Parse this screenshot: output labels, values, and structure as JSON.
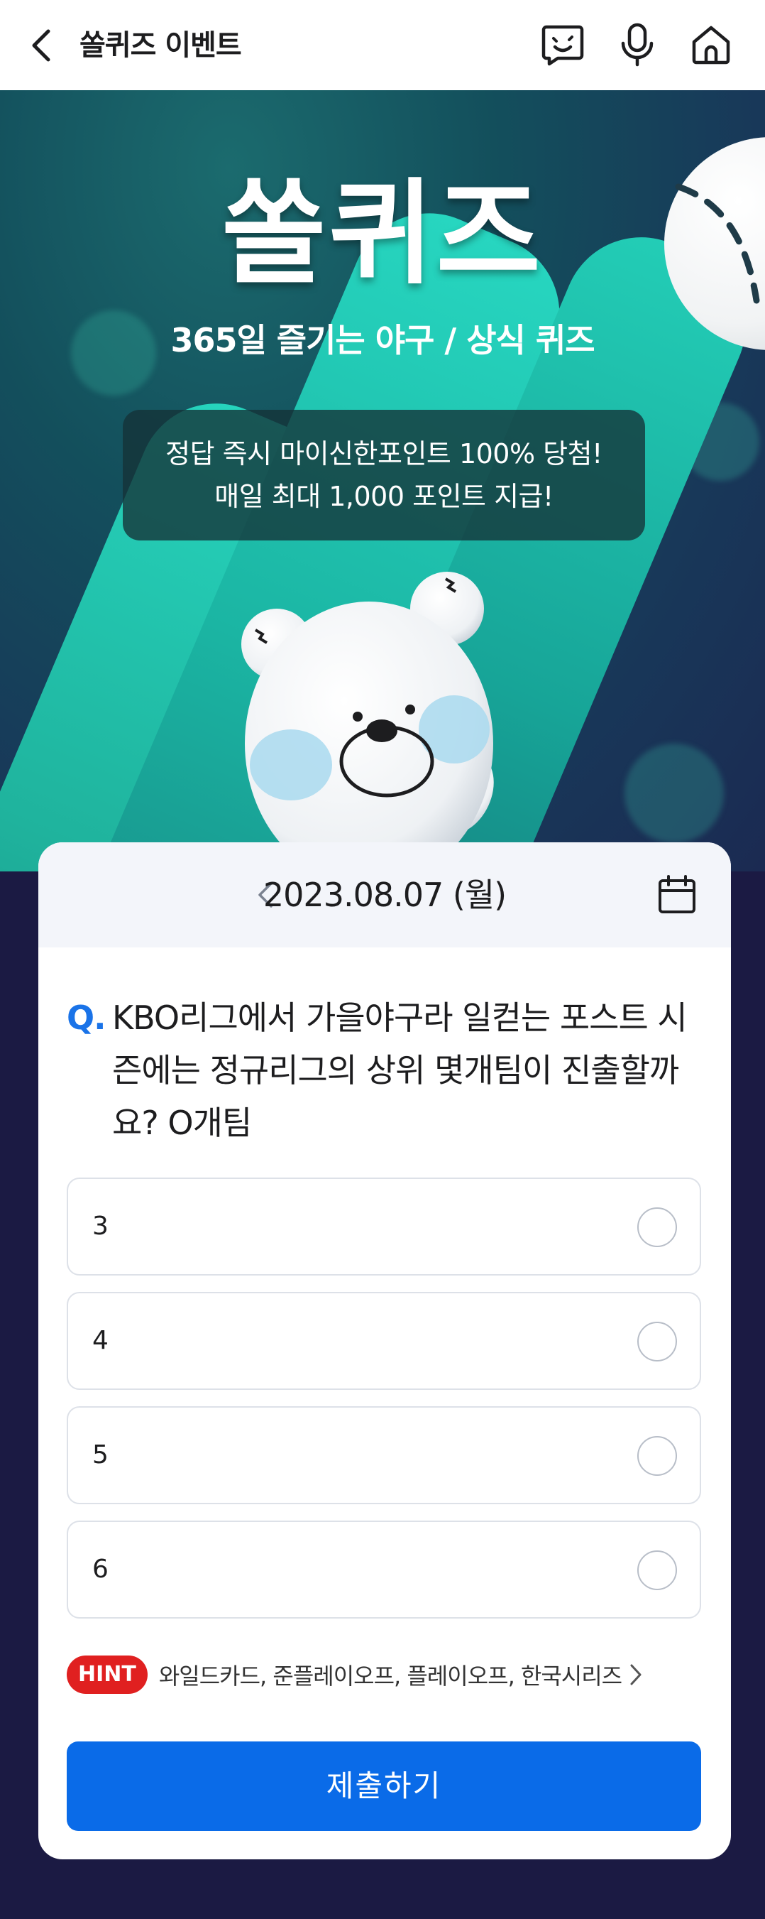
{
  "header": {
    "title": "쏠퀴즈 이벤트",
    "icons": [
      "back-arrow-icon",
      "chatbot-icon",
      "microphone-icon",
      "home-icon"
    ]
  },
  "hero": {
    "title": "쏠퀴즈",
    "subtitle": "365일 즐기는 야구 / 상식 퀴즈",
    "notice_line1": "정답 즉시 마이신한포인트 100% 당첨!",
    "notice_line2": "매일 최대 1,000 포인트 지급!"
  },
  "quiz": {
    "date": "2023.08.07 (월)",
    "q_prefix": "Q.",
    "question": "KBO리그에서 가을야구라 일컫는 포스트 시즌에는 정규리그의 상위 몇개팀이 진출할까요? O개팀",
    "options": [
      "3",
      "4",
      "5",
      "6"
    ],
    "hint_label": "HINT",
    "hint_text": "와일드카드, 준플레이오프, 플레이오프, 한국시리즈",
    "submit_label": "제출하기"
  },
  "colors": {
    "accent": "#0a6be8",
    "q_mark": "#1a73e8",
    "hint_badge": "#e02020",
    "page_bg": "#1b1a43"
  }
}
